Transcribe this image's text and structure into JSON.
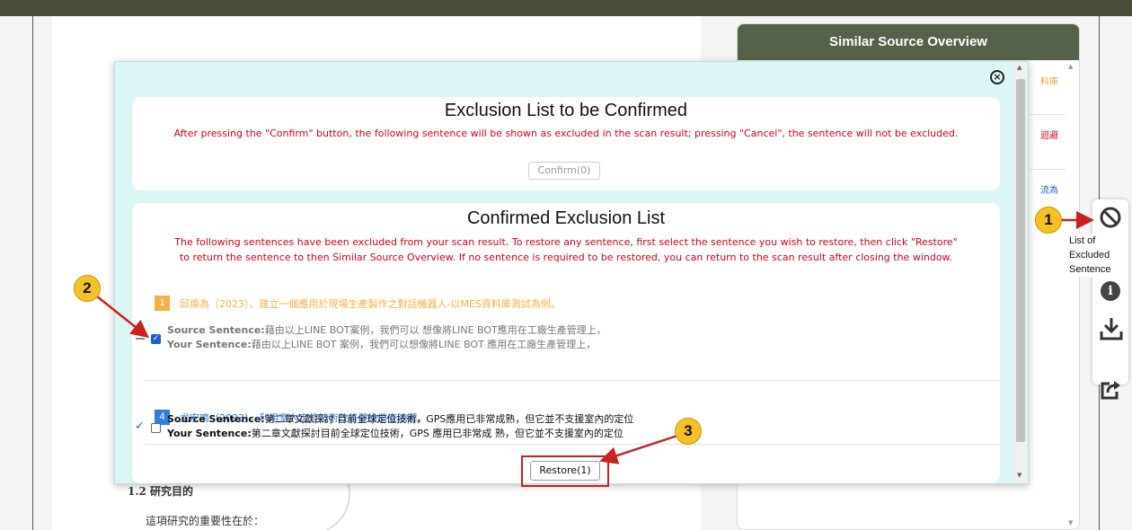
{
  "document": {
    "heading": "1.2 研究目的",
    "paragraph": "這項研究的重要性在於："
  },
  "sso_panel": {
    "title": "Similar Source Overview",
    "snippets": [
      {
        "text": "料庫",
        "color": "#e8a53a"
      },
      {
        "text": "迴避",
        "color": "#d9001b"
      },
      {
        "text": "流為",
        "color": "#1a5fd1"
      }
    ]
  },
  "toolbar": {
    "excluded_tooltip": [
      "List of",
      "Excluded",
      "Sentence"
    ],
    "icons": [
      "ban-icon",
      "info-icon",
      "download-icon",
      "share-icon"
    ]
  },
  "modal": {
    "close_symbol": "×",
    "pending": {
      "title": "Exclusion List to be Confirmed",
      "note": "After pressing the \"Confirm\" button, the following sentence will be shown as excluded in the scan result; pressing \"Cancel\", the sentence will not be excluded.",
      "confirm_label": "Confirm(0)"
    },
    "confirmed": {
      "title": "Confirmed Exclusion List",
      "note_lines": [
        "The following sentences have been excluded from your scan result. To restore any sentence, first select the sentence you wish to restore, then click \"Restore\"",
        "to return the sentence to then Similar Source Overview. If no sentence is required to be restored, you can return to the scan result after closing the window."
      ],
      "items": [
        {
          "badge": "1",
          "badge_color": "#f5b041",
          "source_title": "邱煥為（2023）。建立一個應用於現場生產製作之對話機器人-以MES資料庫測試為例。",
          "source_label": "Source Sentence:",
          "source_text": "藉由以上LINE BOT案例，我們可以 想像將LINE BOT應用在工廠生產管理上，",
          "your_label": "Your Sentence:",
          "your_text": "藉由以上LINE BOT 案例，我們可以想像將LINE BOT 應用在工廠生產管理上，",
          "checked": true
        },
        {
          "badge": "4",
          "badge_color": "#2f7de1",
          "source_title": "尤宏鳴（2023）。利用室內定位技術改善健檢檢查流程。",
          "source_label": "Source Sentence:",
          "source_text": "第二章文獻探討 目前全球定位技術，GPS應用已非常成熟，但它並不支援室內的定位",
          "your_label": "Your Sentence:",
          "your_text": "第二章文獻探討目前全球定位技術，GPS 應用已非常成 熟，但它並不支援室內的定位",
          "checked": false
        }
      ],
      "restore_label": "Restore(1)"
    }
  },
  "markers": [
    "1",
    "2",
    "3"
  ],
  "colors": {
    "accent_green": "#556148",
    "warning_red": "#d9001b",
    "marker_yellow": "#f6c126",
    "modal_bg": "#dcf6f6"
  }
}
